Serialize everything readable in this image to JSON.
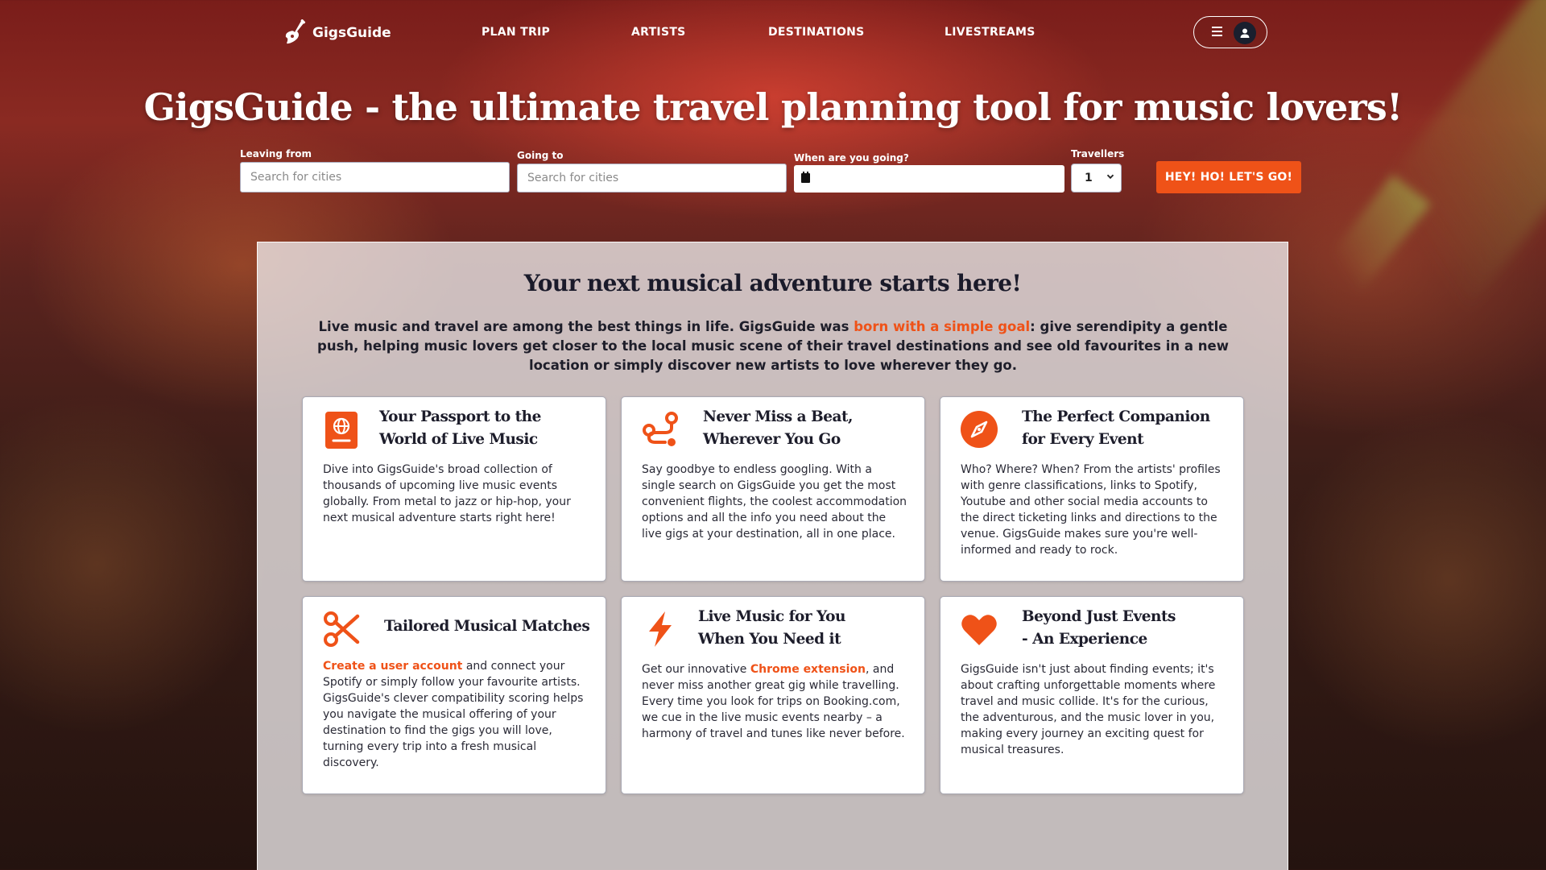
{
  "brand": {
    "name": "GigsGuide"
  },
  "nav": {
    "plan_trip": "PLAN TRIP",
    "artists": "ARTISTS",
    "destinations": "DESTINATIONS",
    "livestreams": "LIVESTREAMS"
  },
  "hero": {
    "title": "GigsGuide - the ultimate travel planning tool for music lovers!"
  },
  "search": {
    "leaving_label": "Leaving from",
    "leaving_placeholder": "Search for cities",
    "going_label": "Going to",
    "going_placeholder": "Search for cities",
    "when_label": "When are you going?",
    "travellers_label": "Travellers",
    "travellers_value": "1",
    "submit_label": "HEY! HO! LET'S GO!"
  },
  "colors": {
    "accent": "#ef5218",
    "heading": "#1d1d2b"
  },
  "about": {
    "heading": "Your next musical adventure starts here!",
    "intro_before": "Live music and travel are among the best things in life. GigsGuide was ",
    "intro_link": "born with a simple goal",
    "intro_after": ": give serendipity a gentle push, helping music lovers get closer to the local music scene of their travel destinations and see old favourites in a new location or simply discover new artists to love wherever they go."
  },
  "cards": [
    {
      "icon": "passport-icon",
      "title_line1": "Your Passport to the",
      "title_line2": "World of Live Music",
      "body": "Dive into GigsGuide's broad collection of thousands of upcoming live music events globally. From metal to jazz or hip-hop, your next musical adventure starts right here!"
    },
    {
      "icon": "route-icon",
      "title_line1": "Never Miss a Beat,",
      "title_line2": "Wherever You Go",
      "body": "Say goodbye to endless googling. With a single search on GigsGuide you get the most convenient flights, the coolest accommodation options and all the info you need about the live gigs at your destination, all in one place."
    },
    {
      "icon": "compass-icon",
      "title_line1": "The Perfect Companion",
      "title_line2": "for Every Event",
      "body": "Who? Where? When? From the artists' profiles with genre classifications, links to Spotify, Youtube and other social media accounts to the direct ticketing links and directions to the venue. GigsGuide makes sure you're well-informed and ready to rock."
    },
    {
      "icon": "scissors-icon",
      "title_line1": "Tailored Musical Matches",
      "body_link": "Create a user account",
      "body_after": " and connect your Spotify or simply follow your favourite artists. GigsGuide's clever compatibility scoring helps you navigate the musical offering of your destination to find the gigs you will love, turning every trip into a fresh musical discovery."
    },
    {
      "icon": "bolt-icon",
      "title_line1": "Live Music for You",
      "title_line2": "When You Need it",
      "body_before": "Get our innovative ",
      "body_link": "Chrome extension",
      "body_after": ", and never miss another great gig while travelling. Every time you look for trips on Booking.com, we cue in the live music events nearby – a harmony of travel and tunes like never before."
    },
    {
      "icon": "heart-icon",
      "title_line1": "Beyond Just Events",
      "title_line2": "- An Experience",
      "body": "GigsGuide isn't just about finding events; it's about crafting unforgettable moments where travel and music collide. It's for the curious, the adventurous, and the music lover in you, making every journey an exciting quest for musical treasures."
    }
  ]
}
